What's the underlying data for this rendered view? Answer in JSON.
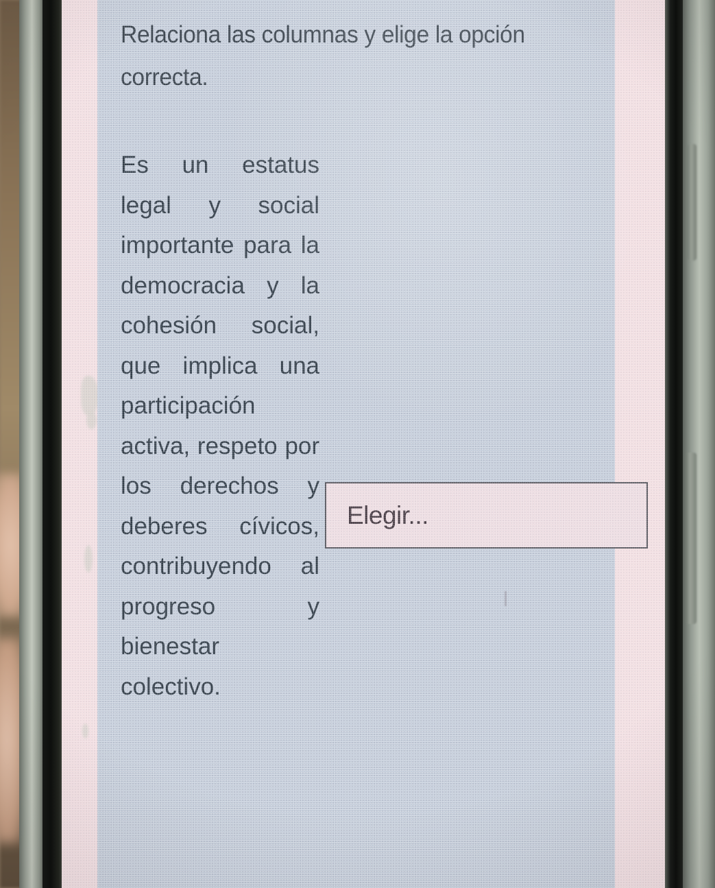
{
  "screen": {
    "prompt": "Relaciona las columnas y elige la opción correcta.",
    "passage": "Es un estatus legal y social importante para la democracia y la cohesión social, que implica una participación activa, respeto por los derechos y deberes cívicos, contribuyendo al progreso y bienestar colectivo.",
    "select": {
      "value": "Elegir...",
      "placeholder": "Elegir...",
      "caret": "chevron-down-icon"
    }
  },
  "colors": {
    "panel_background": "#c3ccd9",
    "screen_background": "#f3e0e3",
    "text": "#333e49",
    "select_background": "#eedee3",
    "select_border": "#55555c",
    "select_text": "#473c44"
  }
}
